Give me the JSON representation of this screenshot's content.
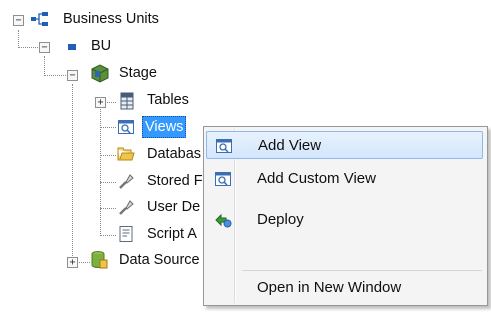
{
  "tree": {
    "root": {
      "label": "Business Units",
      "expander": "−"
    },
    "bu": {
      "label": "BU",
      "expander": "−"
    },
    "stage": {
      "label": "Stage",
      "expander": "−"
    },
    "tables": {
      "label": "Tables",
      "expander": "+"
    },
    "views": {
      "label": "Views"
    },
    "database": {
      "label": "Databas"
    },
    "stored": {
      "label": "Stored F"
    },
    "userdef": {
      "label": "User De"
    },
    "script": {
      "label": "Script A"
    },
    "datasource": {
      "label": "Data Source",
      "expander": "+"
    }
  },
  "context_menu": {
    "items": [
      {
        "label": "Add View",
        "icon": "view-icon",
        "highlighted": true
      },
      {
        "label": "Add Custom View",
        "icon": "view-icon"
      },
      {
        "label": "Deploy",
        "icon": "deploy-icon"
      },
      {
        "label": ""
      },
      {
        "label": "Open in New Window"
      }
    ]
  },
  "colors": {
    "selection": "#3399ff",
    "menu_highlight": "#d3e6fb",
    "menu_highlight_border": "#8fb8ec",
    "menu_background": "#f4f4f4"
  }
}
